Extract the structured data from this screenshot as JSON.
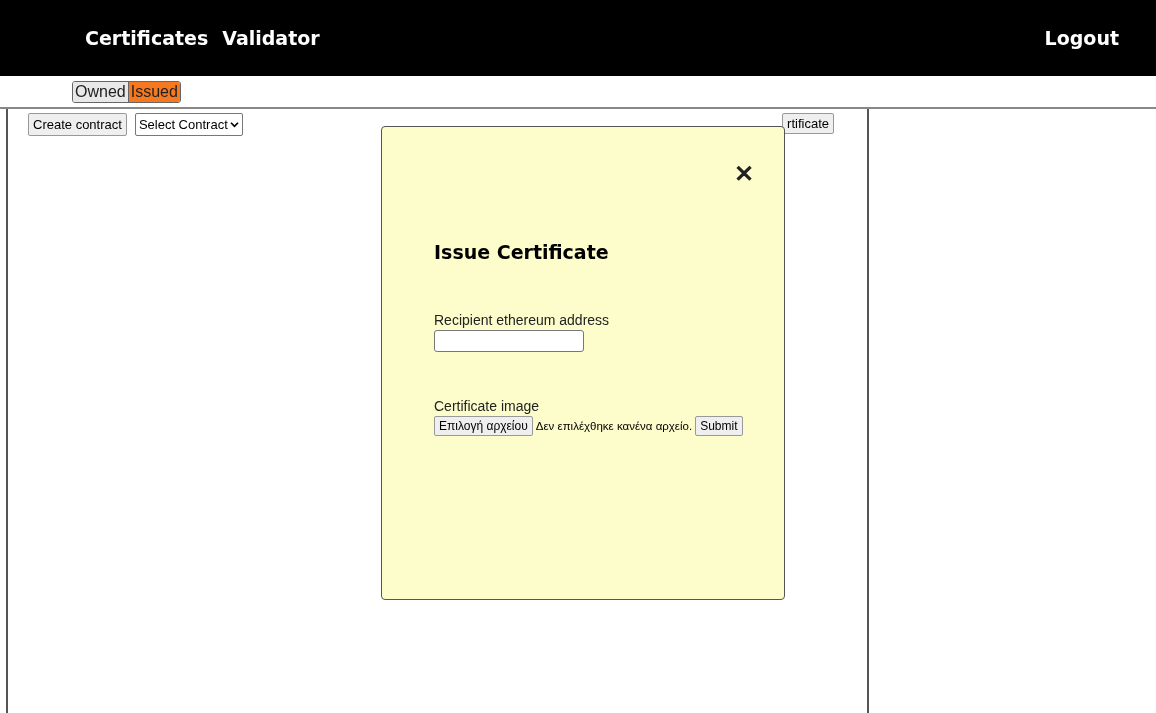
{
  "header": {
    "nav": [
      "Certificates",
      "Validator"
    ],
    "logout": "Logout"
  },
  "tabs": [
    {
      "label": "Owned",
      "selected": false
    },
    {
      "label": "Issued",
      "selected": true
    }
  ],
  "toolbar": {
    "create_button": "Create contract",
    "contract_select": "Select Contract",
    "issue_button": "rtificate"
  },
  "modal": {
    "close": "✕",
    "title": "Issue Certificate",
    "address_label": "Recipient ethereum address",
    "image_label": "Certificate image",
    "file_button": "Επιλογή αρχείου",
    "file_status": "Δεν επιλέχθηκε κανένα αρχείο.",
    "submit": "Submit"
  }
}
